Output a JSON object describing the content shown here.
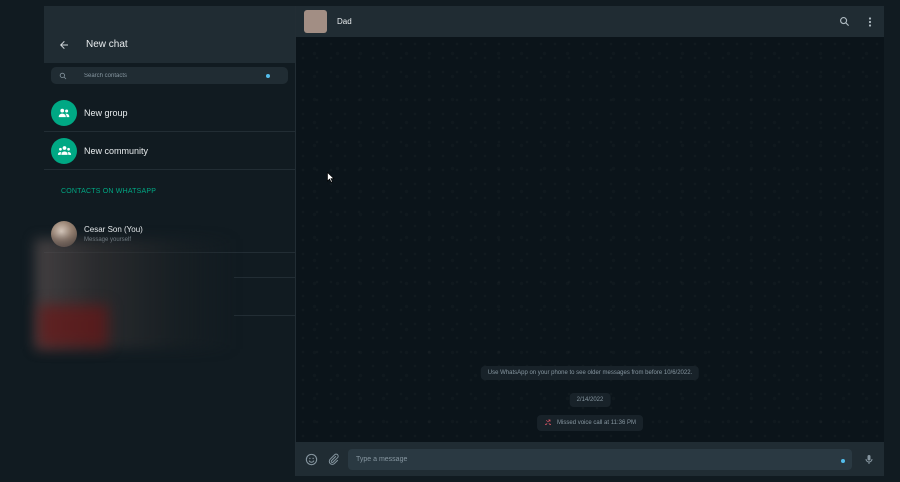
{
  "sidebar": {
    "title": "New chat",
    "search": {
      "placeholder": "Search contacts",
      "value": ""
    },
    "actions": [
      {
        "label": "New group",
        "icon": "group-icon"
      },
      {
        "label": "New community",
        "icon": "community-icon"
      }
    ],
    "section_title": "CONTACTS ON WHATSAPP",
    "contacts": [
      {
        "name": "Cesar Son (You)",
        "subtitle": "Message yourself"
      }
    ]
  },
  "chat": {
    "contact_name": "Dad",
    "header_icons": [
      "search-icon",
      "menu-icon"
    ],
    "system_notice": "Use WhatsApp on your phone to see older messages from before 10/6/2022.",
    "date_chip": "2/14/2022",
    "missed_call": "Missed voice call at 11:36 PM",
    "composer": {
      "placeholder": "Type a message",
      "value": ""
    }
  },
  "colors": {
    "accent": "#00a884",
    "header_bg": "#202c33",
    "panel_bg": "#111b21",
    "chat_bg": "#0b141a",
    "missed_red": "#f15c6d"
  }
}
